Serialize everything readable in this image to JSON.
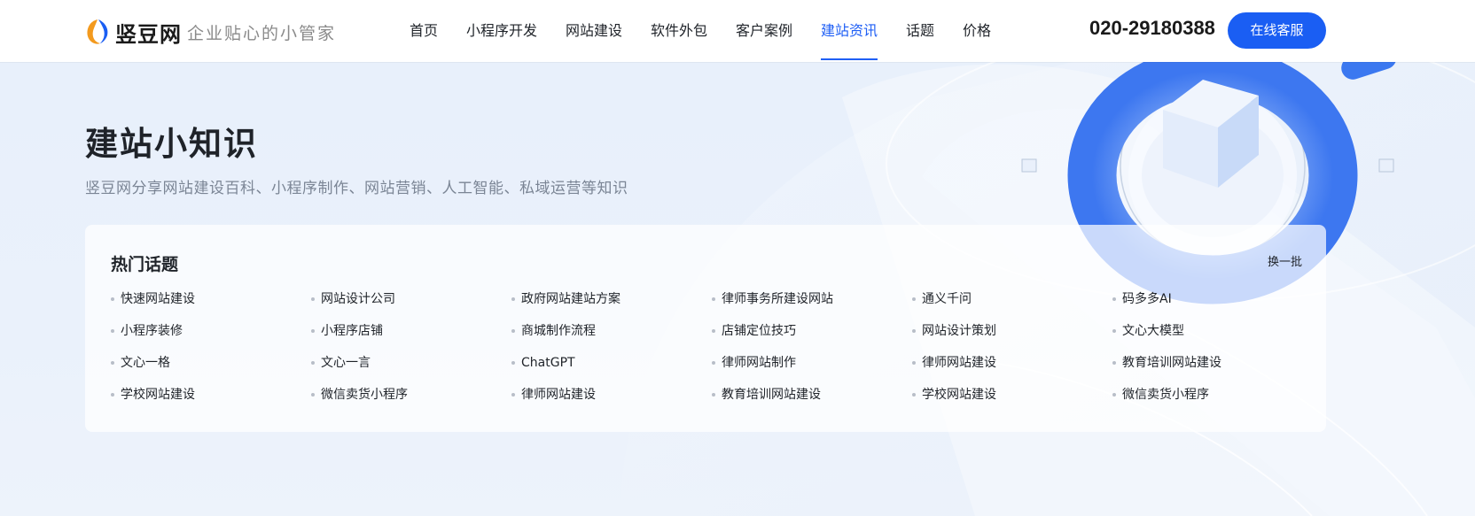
{
  "header": {
    "logo_name": "竖豆网",
    "logo_slogan": "企业贴心的小管家",
    "nav": [
      {
        "label": "首页",
        "active": false
      },
      {
        "label": "小程序开发",
        "active": false
      },
      {
        "label": "网站建设",
        "active": false
      },
      {
        "label": "软件外包",
        "active": false
      },
      {
        "label": "客户案例",
        "active": false
      },
      {
        "label": "建站资讯",
        "active": true
      },
      {
        "label": "话题",
        "active": false
      },
      {
        "label": "价格",
        "active": false
      }
    ],
    "phone": "020-29180388",
    "service_label": "在线客服"
  },
  "banner": {
    "title": "建站小知识",
    "subtitle": "竖豆网分享网站建设百科、小程序制作、网站营销、人工智能、私域运营等知识"
  },
  "topics": {
    "title": "热门话题",
    "refresh_label": "换一批",
    "items": [
      "快速网站建设",
      "网站设计公司",
      "政府网站建站方案",
      "律师事务所建设网站",
      "通义千问",
      "码多多AI",
      "小程序装修",
      "小程序店铺",
      "商城制作流程",
      "店铺定位技巧",
      "网站设计策划",
      "文心大模型",
      "文心一格",
      "文心一言",
      "ChatGPT",
      "律师网站制作",
      "律师网站建设",
      "教育培训网站建设",
      "学校网站建设",
      "微信卖货小程序",
      "律师网站建设",
      "教育培训网站建设",
      "学校网站建设",
      "微信卖货小程序"
    ]
  },
  "colors": {
    "accent": "#1f5ff5",
    "button": "#1a5ef3",
    "banner_bg": "#e8f0fb",
    "muted_text": "#7b8595"
  },
  "icons": {
    "logo": "douzi-logo-icon",
    "bullet": "dot-icon"
  }
}
